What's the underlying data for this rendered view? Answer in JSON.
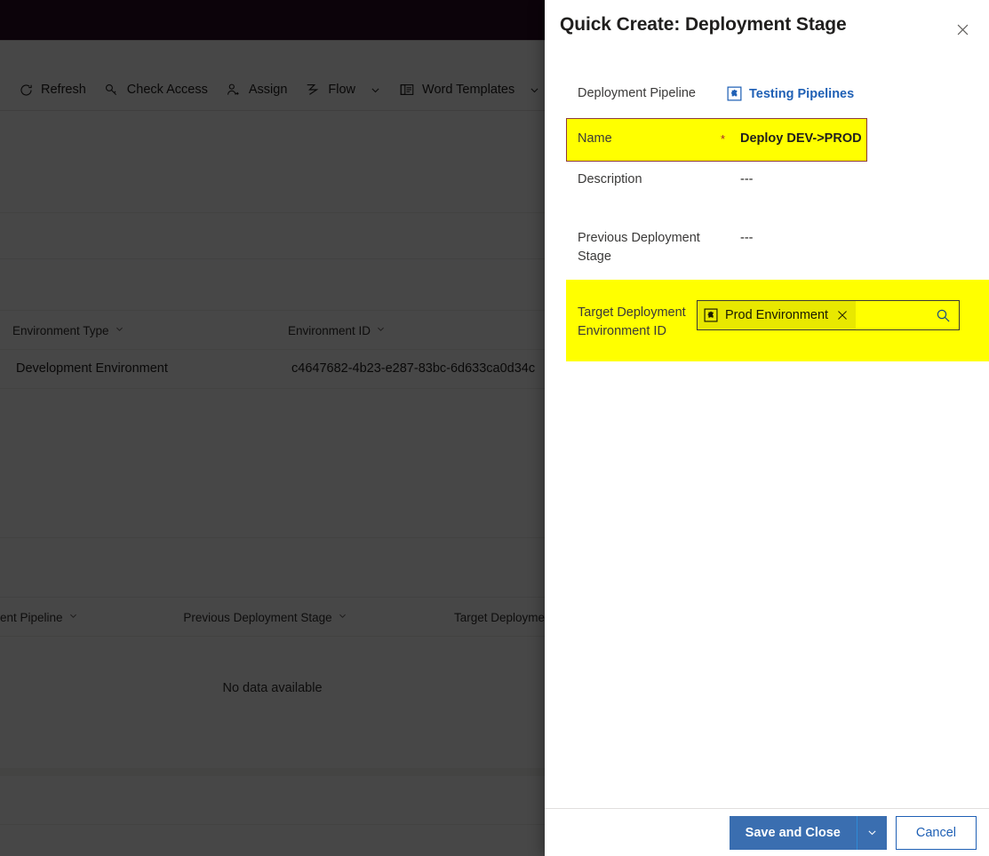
{
  "background": {
    "command_bar": [
      {
        "label": "Refresh",
        "icon": "refresh-icon",
        "has_chevron": false
      },
      {
        "label": "Check Access",
        "icon": "key-icon",
        "has_chevron": false
      },
      {
        "label": "Assign",
        "icon": "person-assign-icon",
        "has_chevron": false
      },
      {
        "label": "Flow",
        "icon": "flow-icon",
        "has_chevron": true
      },
      {
        "label": "Word Templates",
        "icon": "word-doc-icon",
        "has_chevron": true
      },
      {
        "label": "",
        "icon": "run-report-icon",
        "has_chevron": false
      }
    ],
    "grid_top": {
      "columns": [
        "Environment Type",
        "Environment ID"
      ],
      "rows": [
        [
          "Development Environment",
          "c4647682-4b23-e287-83bc-6d633ca0d34c"
        ]
      ]
    },
    "grid_bottom": {
      "columns": [
        "ent Pipeline",
        "Previous Deployment Stage",
        "Target Deployme"
      ],
      "empty_message": "No data available"
    },
    "colors": {
      "topbar": "#2b0b26",
      "dim_overlay": "rgba(0,0,0,0.72)"
    }
  },
  "panel": {
    "title": "Quick Create: Deployment Stage",
    "close_icon": "close-icon",
    "fields": [
      {
        "label": "Deployment Pipeline",
        "type": "link",
        "value": "Testing Pipelines",
        "icon": "pipeline-entity-icon",
        "required": false,
        "highlighted": false
      },
      {
        "label": "Name",
        "type": "text",
        "value": "Deploy DEV->PROD",
        "required": true,
        "required_marker": "*",
        "highlighted": true
      },
      {
        "label": "Description",
        "type": "text",
        "value": "---",
        "required": false,
        "highlighted": false
      },
      {
        "label": "Previous Deployment Stage",
        "type": "text",
        "value": "---",
        "required": false,
        "highlighted": false
      },
      {
        "label": "Target Deployment Environment ID",
        "type": "lookup",
        "value": "Prod Environment",
        "icon": "environment-entity-icon",
        "clear_icon": "clear-chip-icon",
        "search_icon": "search-icon",
        "required": false,
        "highlighted": true
      }
    ],
    "footer": {
      "save_label": "Save and Close",
      "save_split_icon": "chevron-down-icon",
      "cancel_label": "Cancel"
    },
    "colors": {
      "highlight": "#ffff00",
      "primary_button": "#3a6eb0",
      "link": "#1f60b5",
      "required_star": "#a4262c"
    }
  }
}
